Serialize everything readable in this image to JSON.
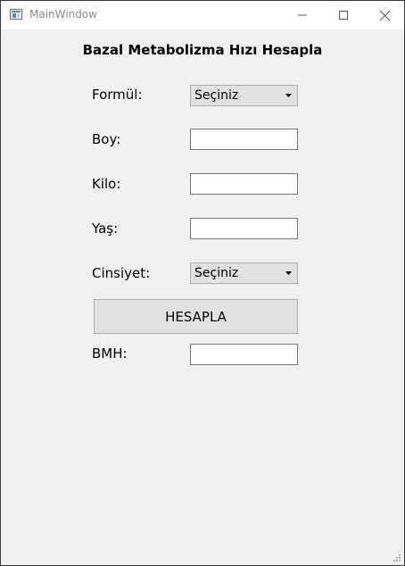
{
  "window": {
    "title": "MainWindow",
    "icons": {
      "app": "window-app-icon",
      "minimize": "minimize-icon",
      "maximize": "maximize-icon",
      "close": "close-icon"
    }
  },
  "form": {
    "heading": "Bazal Metabolizma Hızı Hesapla",
    "formula": {
      "label": "Formül:",
      "selected": "Seçiniz"
    },
    "height": {
      "label": "Boy:",
      "value": ""
    },
    "weight": {
      "label": "Kilo:",
      "value": ""
    },
    "age": {
      "label": "Yaş:",
      "value": ""
    },
    "gender": {
      "label": "Cinsiyet:",
      "selected": "Seçiniz"
    },
    "calculate_label": "HESAPLA",
    "result": {
      "label": "BMH:",
      "value": ""
    }
  }
}
